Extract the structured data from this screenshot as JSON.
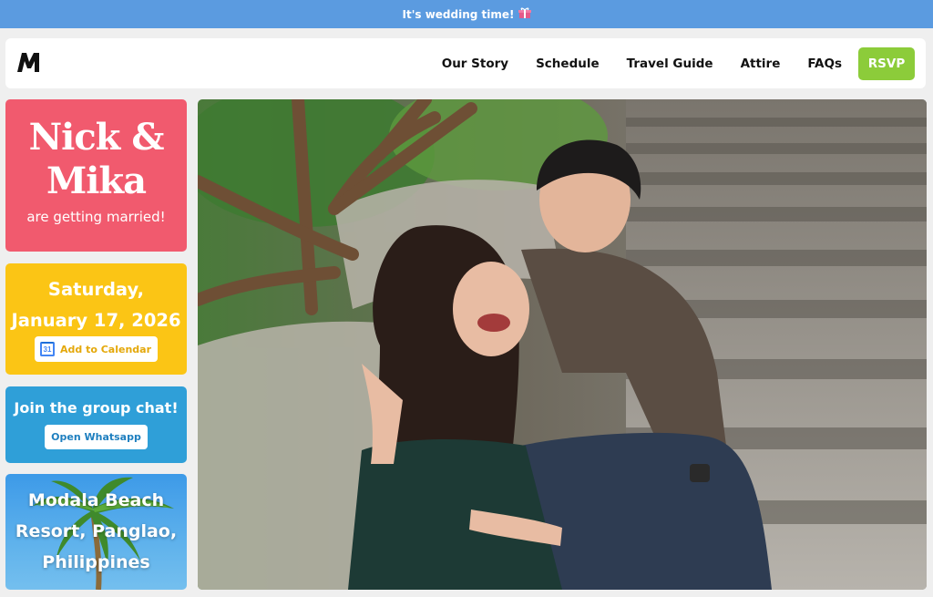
{
  "banner": {
    "text": "It's wedding time!",
    "icon": "gift-icon"
  },
  "nav": {
    "logo": "M-logo",
    "links": [
      "Our Story",
      "Schedule",
      "Travel Guide",
      "Attire",
      "FAQs"
    ],
    "rsvp": "RSVP"
  },
  "couple": {
    "names_line1": "Nick &",
    "names_line2": "Mika",
    "tagline": "are getting married!"
  },
  "date": {
    "line1": "Saturday,",
    "line2": "January 17, 2026",
    "calendar_icon_day": "31",
    "add_to_calendar": "Add to Calendar"
  },
  "chat": {
    "title": "Join the group chat!",
    "button": "Open Whatsapp"
  },
  "location": {
    "line1": "Modala Beach",
    "line2": "Resort, Panglao,",
    "line3": "Philippines"
  },
  "colors": {
    "banner": "#5b9be0",
    "rsvp": "#8ccc3a",
    "names_card": "#f15a6e",
    "date_card": "#fbc515",
    "chat_card": "#2f9fd8",
    "location_card": "#3d9ae8"
  }
}
